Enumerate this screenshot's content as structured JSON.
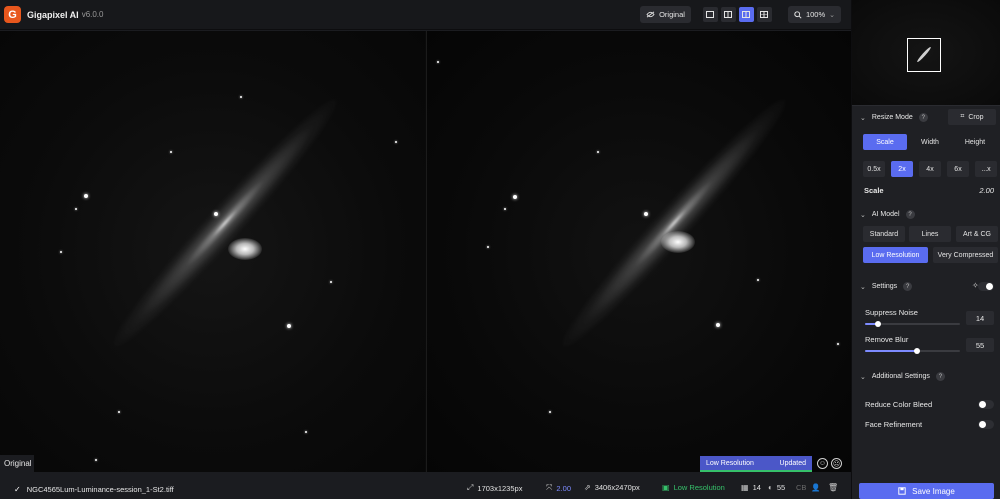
{
  "app": {
    "name": "Gigapixel AI",
    "version": "v6.0.0",
    "logo_letter": "G",
    "accent_color": "#5a6cf0",
    "logo_color": "#e8571d"
  },
  "topbar": {
    "original_label": "Original",
    "zoom_value": "100%",
    "zoom_caret": "⌄",
    "view_modes": [
      {
        "name": "single-view",
        "active": false
      },
      {
        "name": "split-view",
        "active": false
      },
      {
        "name": "side-by-side-view",
        "active": true
      },
      {
        "name": "grid-view",
        "active": false
      }
    ]
  },
  "canvas": {
    "original_tag": "Original",
    "status_model": "Low Resolution",
    "status_state": "Updated"
  },
  "bottombar": {
    "file_name": "NGC4565Lum-Luminance-session_1-St2.tiff",
    "input_size": "1703x1235px",
    "scale": "2.00",
    "output_size": "3406x2470px",
    "model": "Low Resolution",
    "noise": "14",
    "blur": "55",
    "cb_label": "CB"
  },
  "sidebar": {
    "resize_mode": {
      "title": "Resize Mode",
      "crop_label": "Crop",
      "tabs": [
        "Scale",
        "Width",
        "Height"
      ],
      "active_tab": "Scale",
      "presets": [
        "0.5x",
        "2x",
        "4x",
        "6x",
        "...x"
      ],
      "active_preset": "2x",
      "scale_label": "Scale",
      "scale_value": "2.00"
    },
    "ai_model": {
      "title": "AI Model",
      "options": [
        "Standard",
        "Lines",
        "Art & CG",
        "Low Resolution",
        "Very Compressed"
      ],
      "active": "Low Resolution"
    },
    "settings": {
      "title": "Settings",
      "suppress_noise_label": "Suppress Noise",
      "suppress_noise_value": "14",
      "suppress_noise_fraction": 0.14,
      "remove_blur_label": "Remove Blur",
      "remove_blur_value": "55",
      "remove_blur_fraction": 0.55
    },
    "additional_settings": {
      "title": "Additional Settings",
      "reduce_color_bleed_label": "Reduce Color Bleed",
      "face_refinement_label": "Face Refinement"
    },
    "save_label": "Save Image"
  }
}
